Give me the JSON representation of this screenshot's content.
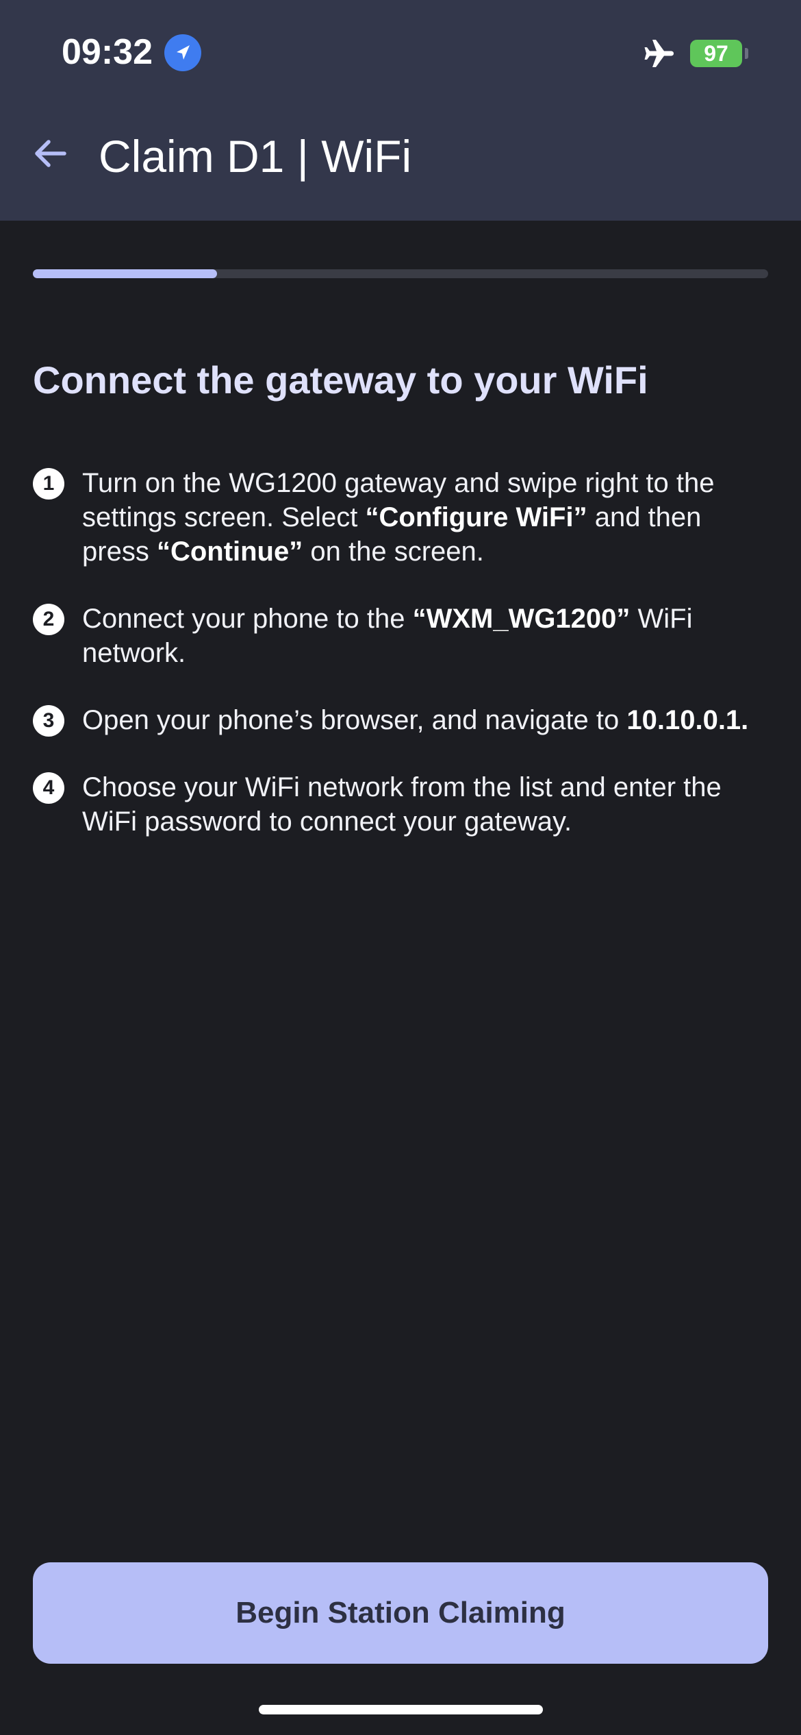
{
  "status_bar": {
    "time": "09:32",
    "battery_level": "97"
  },
  "header": {
    "title": "Claim D1 | WiFi"
  },
  "progress": {
    "fraction": 0.25
  },
  "main": {
    "title": "Connect the gateway to your WiFi",
    "steps": [
      {
        "number": "1",
        "parts": [
          {
            "text": "Turn on the WG1200 gateway and swipe right to the settings screen. Select ",
            "bold": false
          },
          {
            "text": "“Configure WiFi”",
            "bold": true
          },
          {
            "text": " and then press ",
            "bold": false
          },
          {
            "text": "“Continue”",
            "bold": true
          },
          {
            "text": " on the screen.",
            "bold": false
          }
        ]
      },
      {
        "number": "2",
        "parts": [
          {
            "text": "Connect your phone to the ",
            "bold": false
          },
          {
            "text": "“WXM_WG1200”",
            "bold": true
          },
          {
            "text": " WiFi network.",
            "bold": false
          }
        ]
      },
      {
        "number": "3",
        "parts": [
          {
            "text": "Open your phone’s browser, and navigate to ",
            "bold": false
          },
          {
            "text": "10.10.0.1.",
            "bold": true
          }
        ]
      },
      {
        "number": "4",
        "parts": [
          {
            "text": "Choose your WiFi network from the list and enter the WiFi password to connect your gateway.",
            "bold": false
          }
        ]
      }
    ]
  },
  "footer": {
    "button_label": "Begin Station Claiming"
  },
  "icons": {
    "back": "arrow-left-icon",
    "location": "location-arrow-icon",
    "airplane": "airplane-icon",
    "battery": "battery-charging-icon"
  },
  "colors": {
    "accent": "#b6bef7",
    "header_bg": "#33374b",
    "page_bg": "#1c1d22",
    "battery": "#5fc65a",
    "location": "#3f7cf0"
  }
}
